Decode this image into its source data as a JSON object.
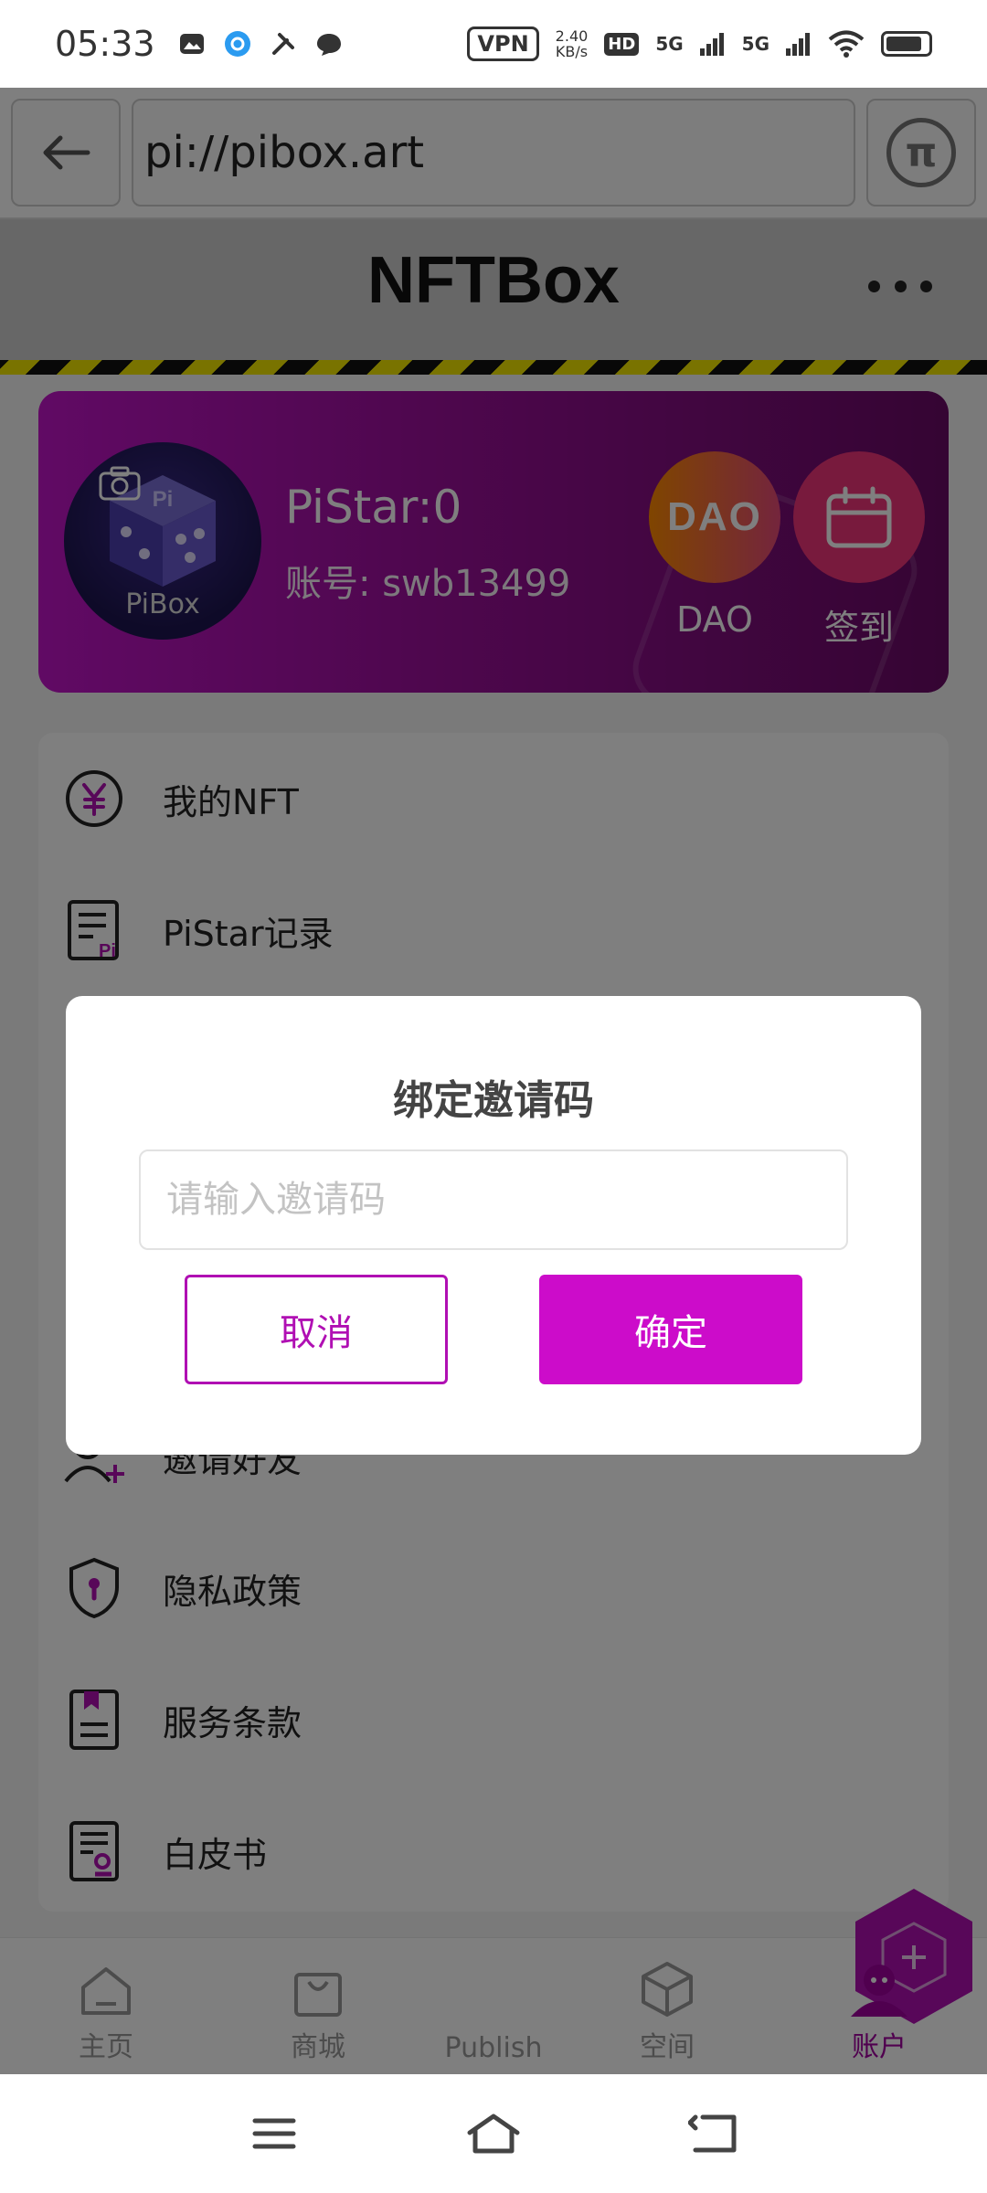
{
  "status_bar": {
    "time": "05:33",
    "vpn": "VPN",
    "speed_value": "2.40",
    "speed_unit": "KB/s",
    "hd": "HD",
    "signal_1": "5G",
    "signal_2": "5G"
  },
  "browser": {
    "url": "pi://pibox.art"
  },
  "app": {
    "title": "NFTBox"
  },
  "profile": {
    "avatar_label": "PiBox",
    "pistar": "PiStar:0",
    "account": "账号: swb13499",
    "dao_logo": "DAO",
    "dao_label": "DAO",
    "checkin_label": "签到"
  },
  "menu": {
    "items": [
      {
        "label": "我的NFT",
        "icon": "yen-circle-icon"
      },
      {
        "label": "PiStar记录",
        "icon": "pi-record-icon"
      },
      {
        "label": "邀请好友",
        "icon": "add-user-icon"
      },
      {
        "label": "隐私政策",
        "icon": "shield-keyhole-icon"
      },
      {
        "label": "服务条款",
        "icon": "bookmark-doc-icon"
      },
      {
        "label": "白皮书",
        "icon": "certificate-doc-icon"
      }
    ]
  },
  "tabs": [
    {
      "label": "主页",
      "icon": "home-icon"
    },
    {
      "label": "商城",
      "icon": "shopping-bag-icon"
    },
    {
      "label": "Publish",
      "icon": "hexagon-plus-icon"
    },
    {
      "label": "空间",
      "icon": "cube-icon"
    },
    {
      "label": "账户",
      "icon": "user-icon",
      "active": true
    }
  ],
  "dialog": {
    "title": "绑定邀请码",
    "input_placeholder": "请输入邀请码",
    "input_value": "",
    "cancel_label": "取消",
    "confirm_label": "确定"
  },
  "colors": {
    "accent": "#cc0cca",
    "card_gradient_start": "#c214c9",
    "card_gradient_end": "#6a0a66",
    "hazard_yellow": "#f2e600"
  }
}
